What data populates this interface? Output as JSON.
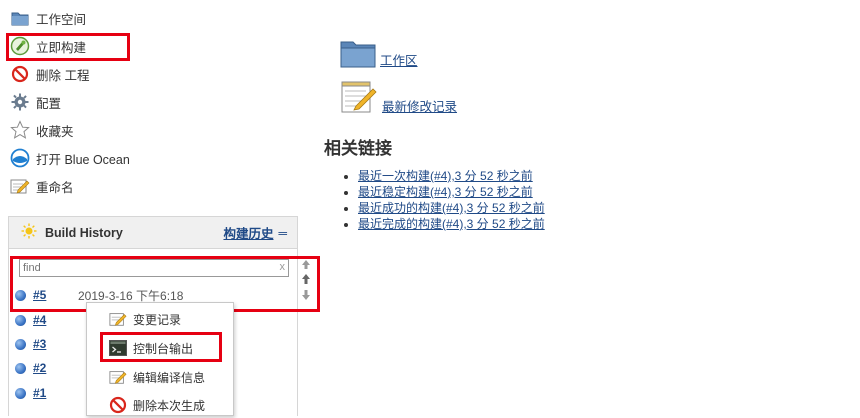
{
  "tasks": [
    {
      "label": "工作空间",
      "icon": "folder-icon"
    },
    {
      "label": "立即构建",
      "icon": "build-now-icon"
    },
    {
      "label": "删除 工程",
      "icon": "no-entry-icon"
    },
    {
      "label": "配置",
      "icon": "gear-icon"
    },
    {
      "label": "收藏夹",
      "icon": "star-icon"
    },
    {
      "label": "打开 Blue Ocean",
      "icon": "blue-ocean-icon"
    },
    {
      "label": "重命名",
      "icon": "notepad-icon"
    }
  ],
  "build_history": {
    "title": "Build History",
    "trend_label": "构建历史",
    "dash": "═",
    "search_placeholder": "find",
    "clear_symbol": "x",
    "builds": [
      {
        "number": "#5",
        "date": "2019-3-16 下午6:18"
      },
      {
        "number": "#4",
        "date": ""
      },
      {
        "number": "#3",
        "date": ""
      },
      {
        "number": "#2",
        "date": ""
      },
      {
        "number": "#1",
        "date": ""
      }
    ]
  },
  "context_menu": {
    "items": [
      {
        "label": "变更记录",
        "icon": "notepad-icon"
      },
      {
        "label": "控制台输出",
        "icon": "terminal-icon"
      },
      {
        "label": "编辑编译信息",
        "icon": "notepad-icon"
      },
      {
        "label": "删除本次生成",
        "icon": "no-entry-icon"
      }
    ]
  },
  "main": {
    "workspace_link": "工作区",
    "changes_link": "最新修改记录",
    "related_title": "相关链接",
    "related_links": [
      "最近一次构建(#4),3 分 52 秒之前",
      "最近稳定构建(#4),3 分 52 秒之前",
      "最近成功的构建(#4),3 分 52 秒之前",
      "最近完成的构建(#4),3 分 52 秒之前"
    ]
  },
  "colors": {
    "highlight": "#e60012",
    "link": "#204a87",
    "panel_header": "#f0f0f0"
  }
}
